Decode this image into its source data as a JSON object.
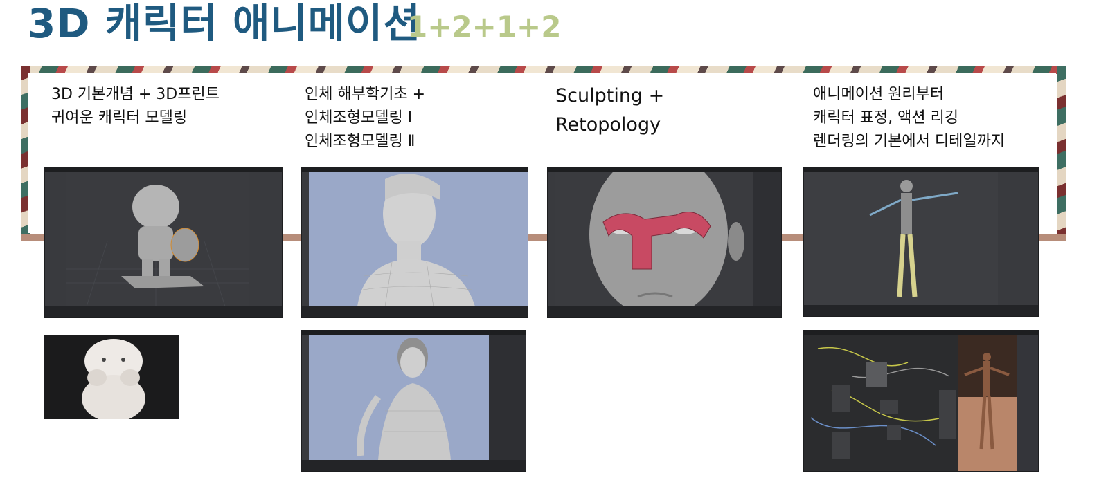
{
  "header": {
    "title": "3D 캐릭터 애니메이션",
    "subtitle": "1+2+1+2"
  },
  "columns": [
    {
      "lines": [
        "3D 기본개념 + 3D프린트",
        "귀여운 캐릭터 모델링"
      ]
    },
    {
      "lines": [
        "인체 해부학기초 +",
        "인체조형모델링 Ⅰ",
        "인체조형모델링 Ⅱ"
      ]
    },
    {
      "lines": [
        "Sculpting +",
        "Retopology"
      ]
    },
    {
      "lines": [
        "애니메이션 원리부터",
        "캐릭터 표정, 액션 리깅",
        "렌더링의 기본에서  디테일까지"
      ]
    }
  ],
  "colors": {
    "title": "#1f5a80",
    "subtitle": "#b9c98a",
    "timeline": "#b78d7a",
    "viewport_dark": "#3a3b3f",
    "viewport_blue": "#9aa8c8",
    "retopo_mesh": "#c84a63"
  }
}
